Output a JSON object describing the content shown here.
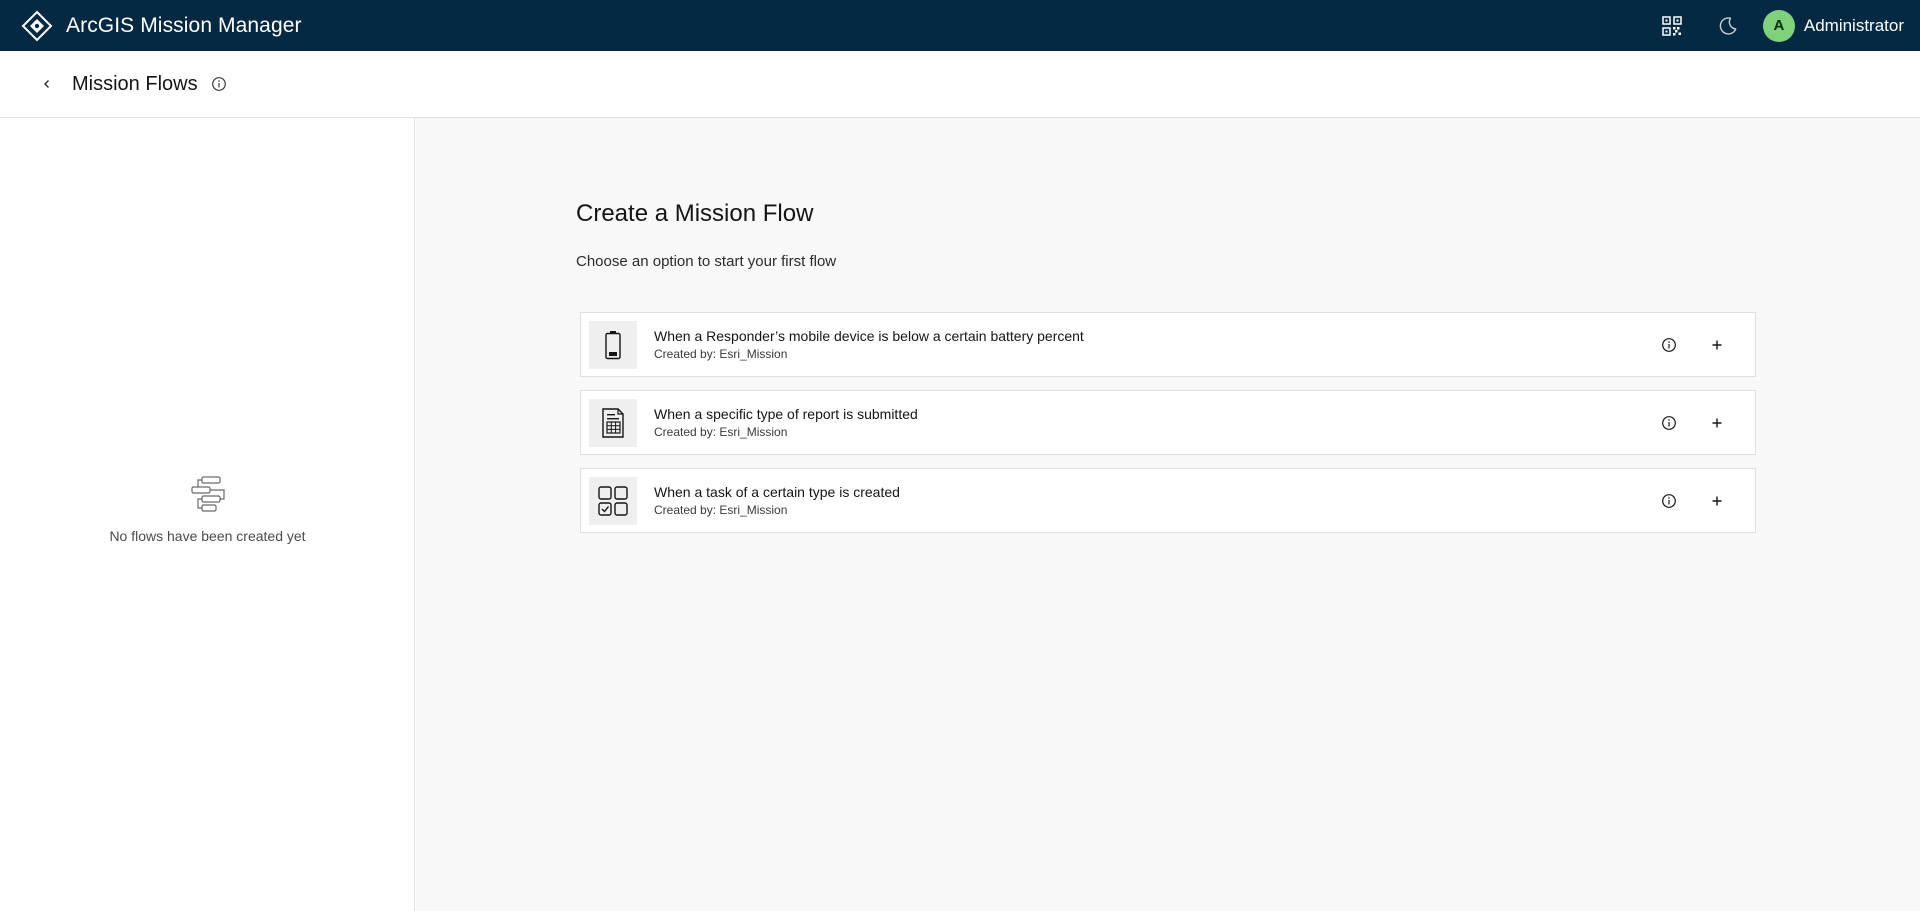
{
  "app": {
    "title": "ArcGIS Mission Manager",
    "user_initial": "A",
    "user_name": "Administrator",
    "icons": {
      "logo": "arcgis-diamond-logo-icon",
      "qr": "qr-code-icon",
      "theme": "moon-icon"
    }
  },
  "header": {
    "title": "Mission Flows",
    "back_icon": "chevron-left-icon",
    "info_icon": "info-icon"
  },
  "sidebar": {
    "empty_text": "No flows have been created yet",
    "empty_icon": "flow-diagram-icon"
  },
  "main": {
    "title": "Create a Mission Flow",
    "subtitle": "Choose an option to start your first flow",
    "options": [
      {
        "title": "When a Responder’s mobile device is below a certain battery percent",
        "author": "Created by: Esri_Mission",
        "icon": "battery-low-icon"
      },
      {
        "title": "When a specific type of report is submitted",
        "author": "Created by: Esri_Mission",
        "icon": "report-form-icon"
      },
      {
        "title": "When a task of a certain type is created",
        "author": "Created by: Esri_Mission",
        "icon": "task-grid-icon"
      }
    ]
  },
  "colors": {
    "topbar": "#052942",
    "avatar": "#7ed37a",
    "main_bg": "#f8f8f8"
  }
}
